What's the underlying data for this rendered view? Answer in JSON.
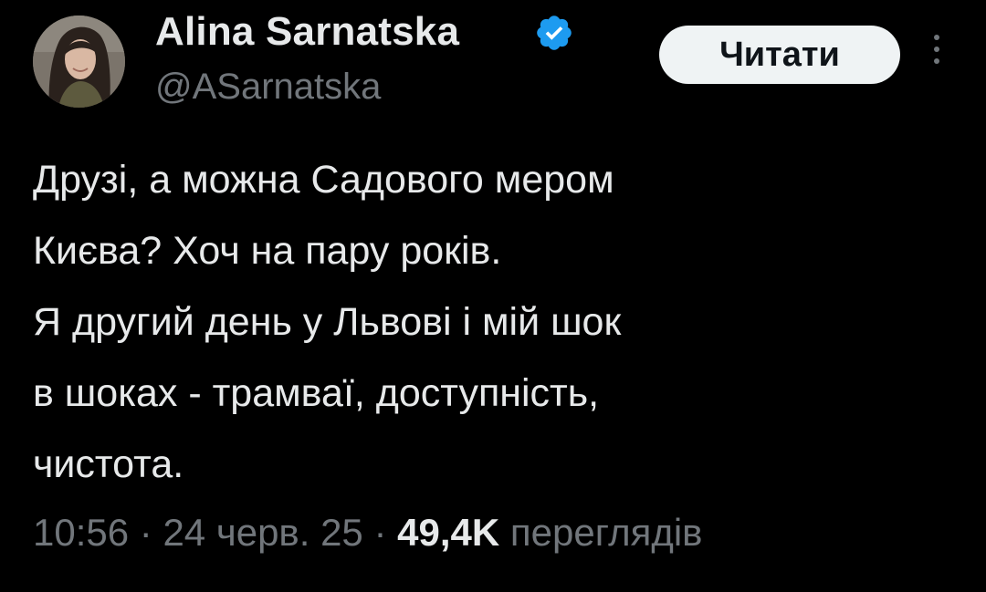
{
  "author": {
    "display_name": "Alina Sarnatska",
    "handle": "@ASarnatska",
    "verified_icon": "verified-badge-icon",
    "avatar_icon": "profile-photo"
  },
  "actions": {
    "follow_label": "Читати",
    "more_icon": "more-vertical-icon"
  },
  "tweet": {
    "lines": [
      "Друзі, а можна Садового мером",
      "Києва? Хоч на пару років.",
      "Я другий день у Львові і мій шок",
      "в шоках - трамваї, доступність,",
      "чистота."
    ]
  },
  "meta": {
    "time": "10:56",
    "separator": " · ",
    "date": "24 черв. 25",
    "views_count": "49,4K",
    "views_label": " переглядів"
  },
  "colors": {
    "background": "#000000",
    "text_primary": "#e7e9ea",
    "text_secondary": "#71767b",
    "verified_blue": "#1d9bf0",
    "button_bg": "#eff3f4"
  }
}
